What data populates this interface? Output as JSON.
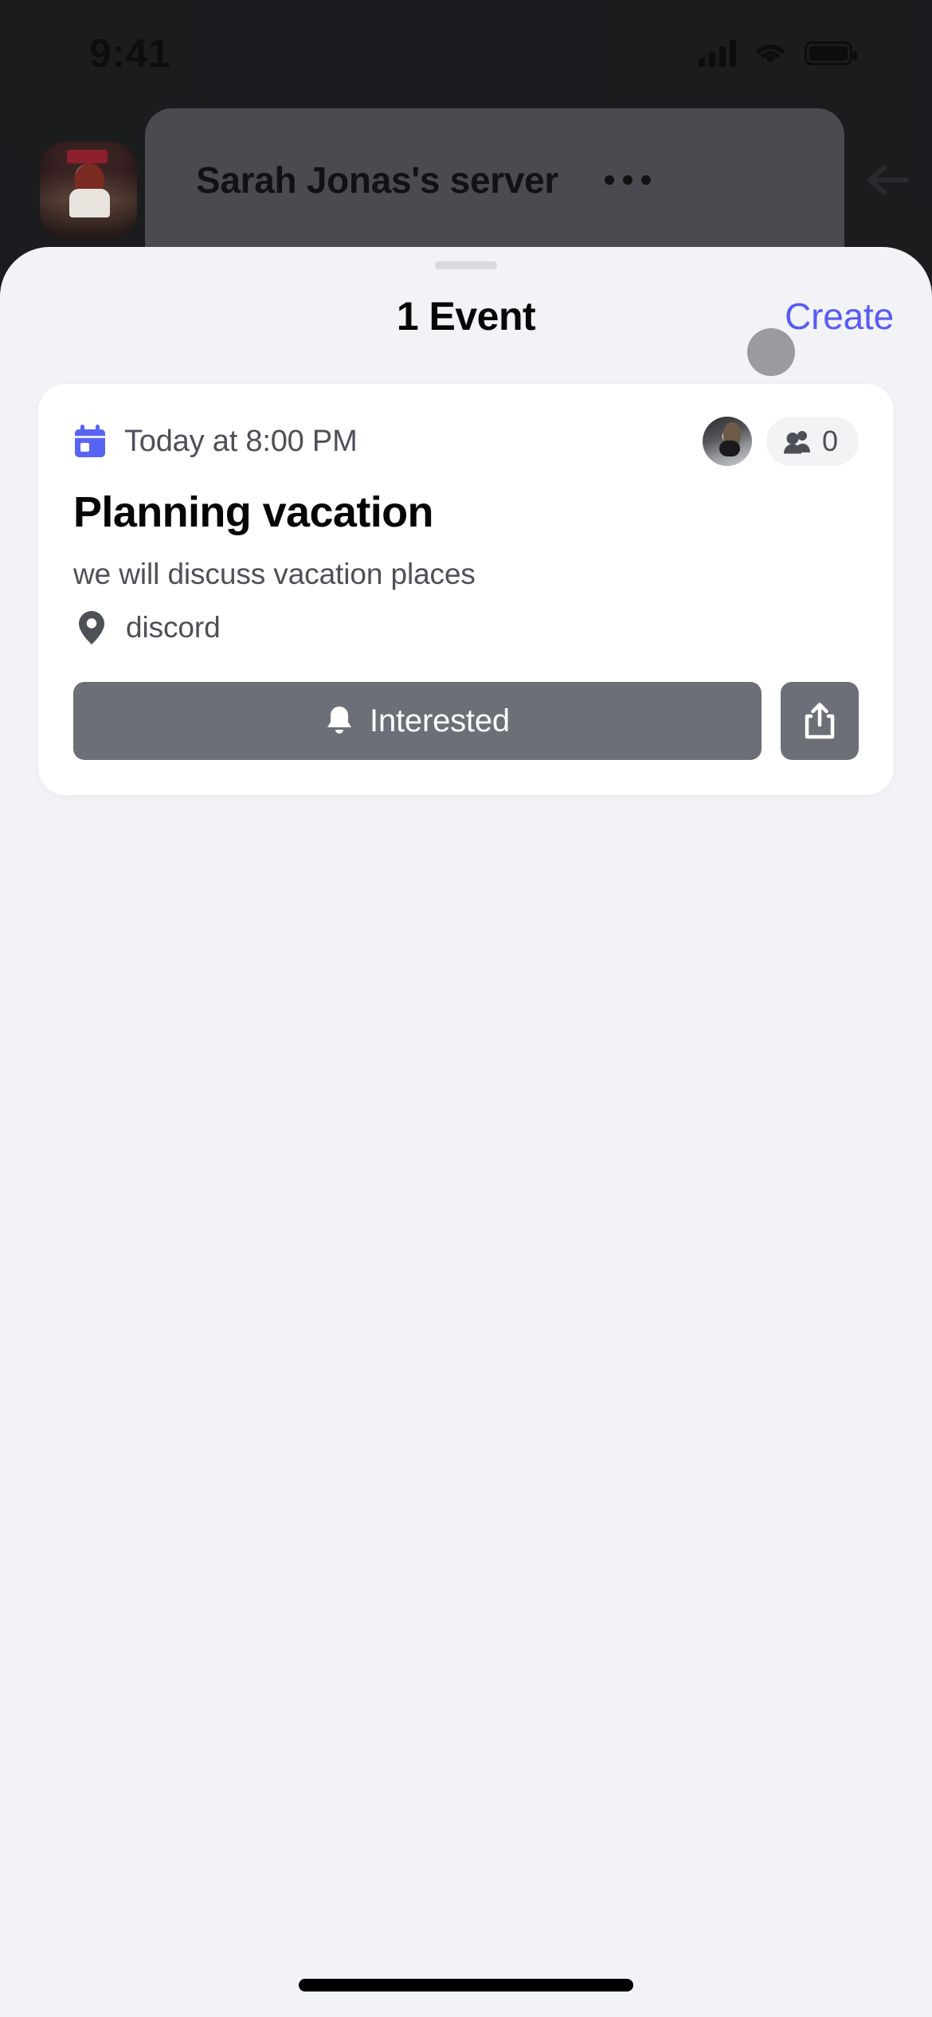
{
  "status_bar": {
    "time": "9:41",
    "icons": [
      "cellular-signal-icon",
      "wifi-icon",
      "battery-icon"
    ]
  },
  "background_app": {
    "server_name": "Sarah Jonas's server",
    "overflow_menu": "more-options-icon",
    "back": "back-arrow-icon",
    "server_avatar": "server-avatar"
  },
  "sheet": {
    "grabber": "drag-handle",
    "title": "1 Event",
    "create_label": "Create",
    "accent_color": "#5A5BF3",
    "background_color": "#F2F3F7"
  },
  "event": {
    "date_icon": "calendar-icon",
    "date_icon_color": "#5865F2",
    "when": "Today at 8:00 PM",
    "host_avatar": "host-avatar",
    "attendees_icon": "people-icon",
    "attendees_count": "0",
    "title": "Planning vacation",
    "description": "we will discuss vacation places",
    "location_icon": "location-pin-icon",
    "location": "discord",
    "interested_icon": "bell-icon",
    "interested_label": "Interested",
    "share_icon": "share-icon",
    "button_color": "#6D6F78"
  },
  "touch_indicator": {
    "name": "tap-indicator",
    "color": "#9B9B9F"
  },
  "home_indicator": "home-indicator"
}
